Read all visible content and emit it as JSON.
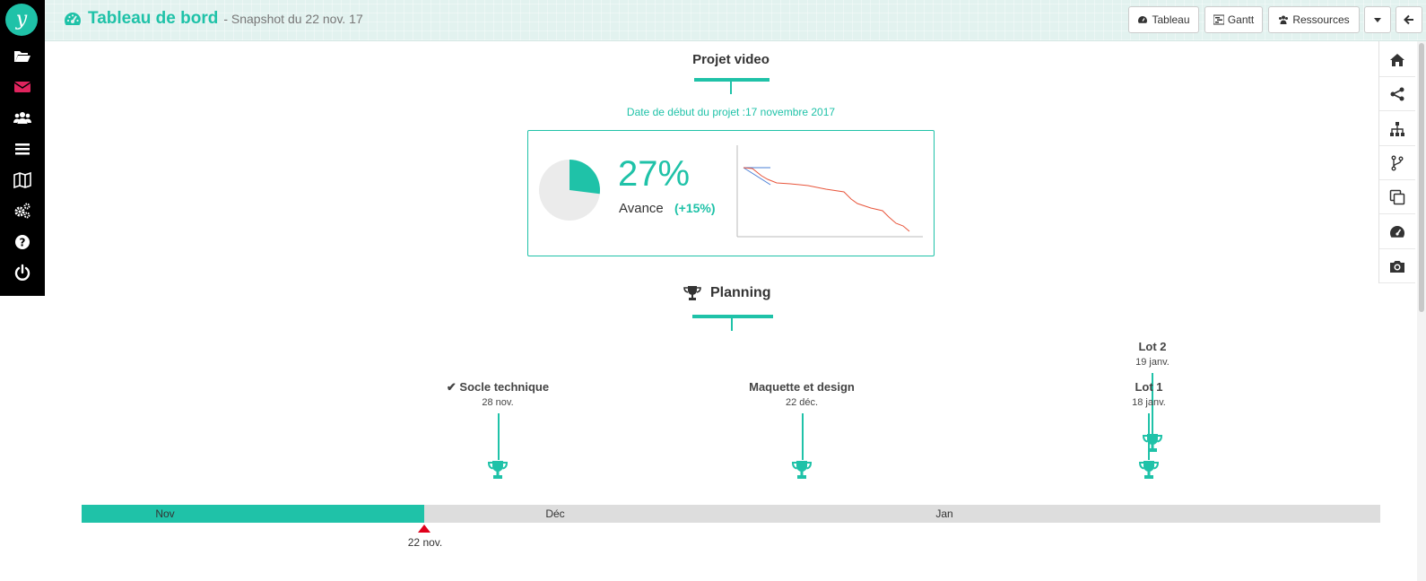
{
  "header": {
    "title": "Tableau de bord",
    "subtitle": "- Snapshot du 22 nov. 17",
    "buttons": {
      "tableau": "Tableau",
      "gantt": "Gantt",
      "ressources": "Ressources"
    }
  },
  "sidebar": {
    "logo": "y",
    "items": [
      "folder-open-icon",
      "envelope-icon",
      "users-icon",
      "menu-icon",
      "map-icon",
      "gears-icon",
      "help-icon",
      "power-icon"
    ]
  },
  "right_toolbar": {
    "items": [
      "home-icon",
      "share-icon",
      "sitemap-icon",
      "branch-icon",
      "copy-icon",
      "dashboard-icon",
      "camera-icon"
    ]
  },
  "project": {
    "title": "Projet video",
    "start_date": "Date de début du projet :17 novembre 2017",
    "progress_percent": "27%",
    "progress_value": 27,
    "avance_label": "Avance",
    "avance_delta": "(+15%)"
  },
  "planning": {
    "title": "Planning",
    "milestones": [
      {
        "name": "✔ Socle technique",
        "date": "28 nov."
      },
      {
        "name": "Maquette et design",
        "date": "22 déc."
      },
      {
        "name": "Lot 2",
        "date": "19 janv."
      },
      {
        "name": "Lot 1",
        "date": "18 janv."
      }
    ],
    "months": [
      "Nov",
      "Déc",
      "Jan"
    ],
    "today_label": "22 nov."
  },
  "colors": {
    "accent": "#1fc2a8",
    "today": "#e0001b",
    "burndown": "#e8553b",
    "plan": "#4a7fd6"
  }
}
